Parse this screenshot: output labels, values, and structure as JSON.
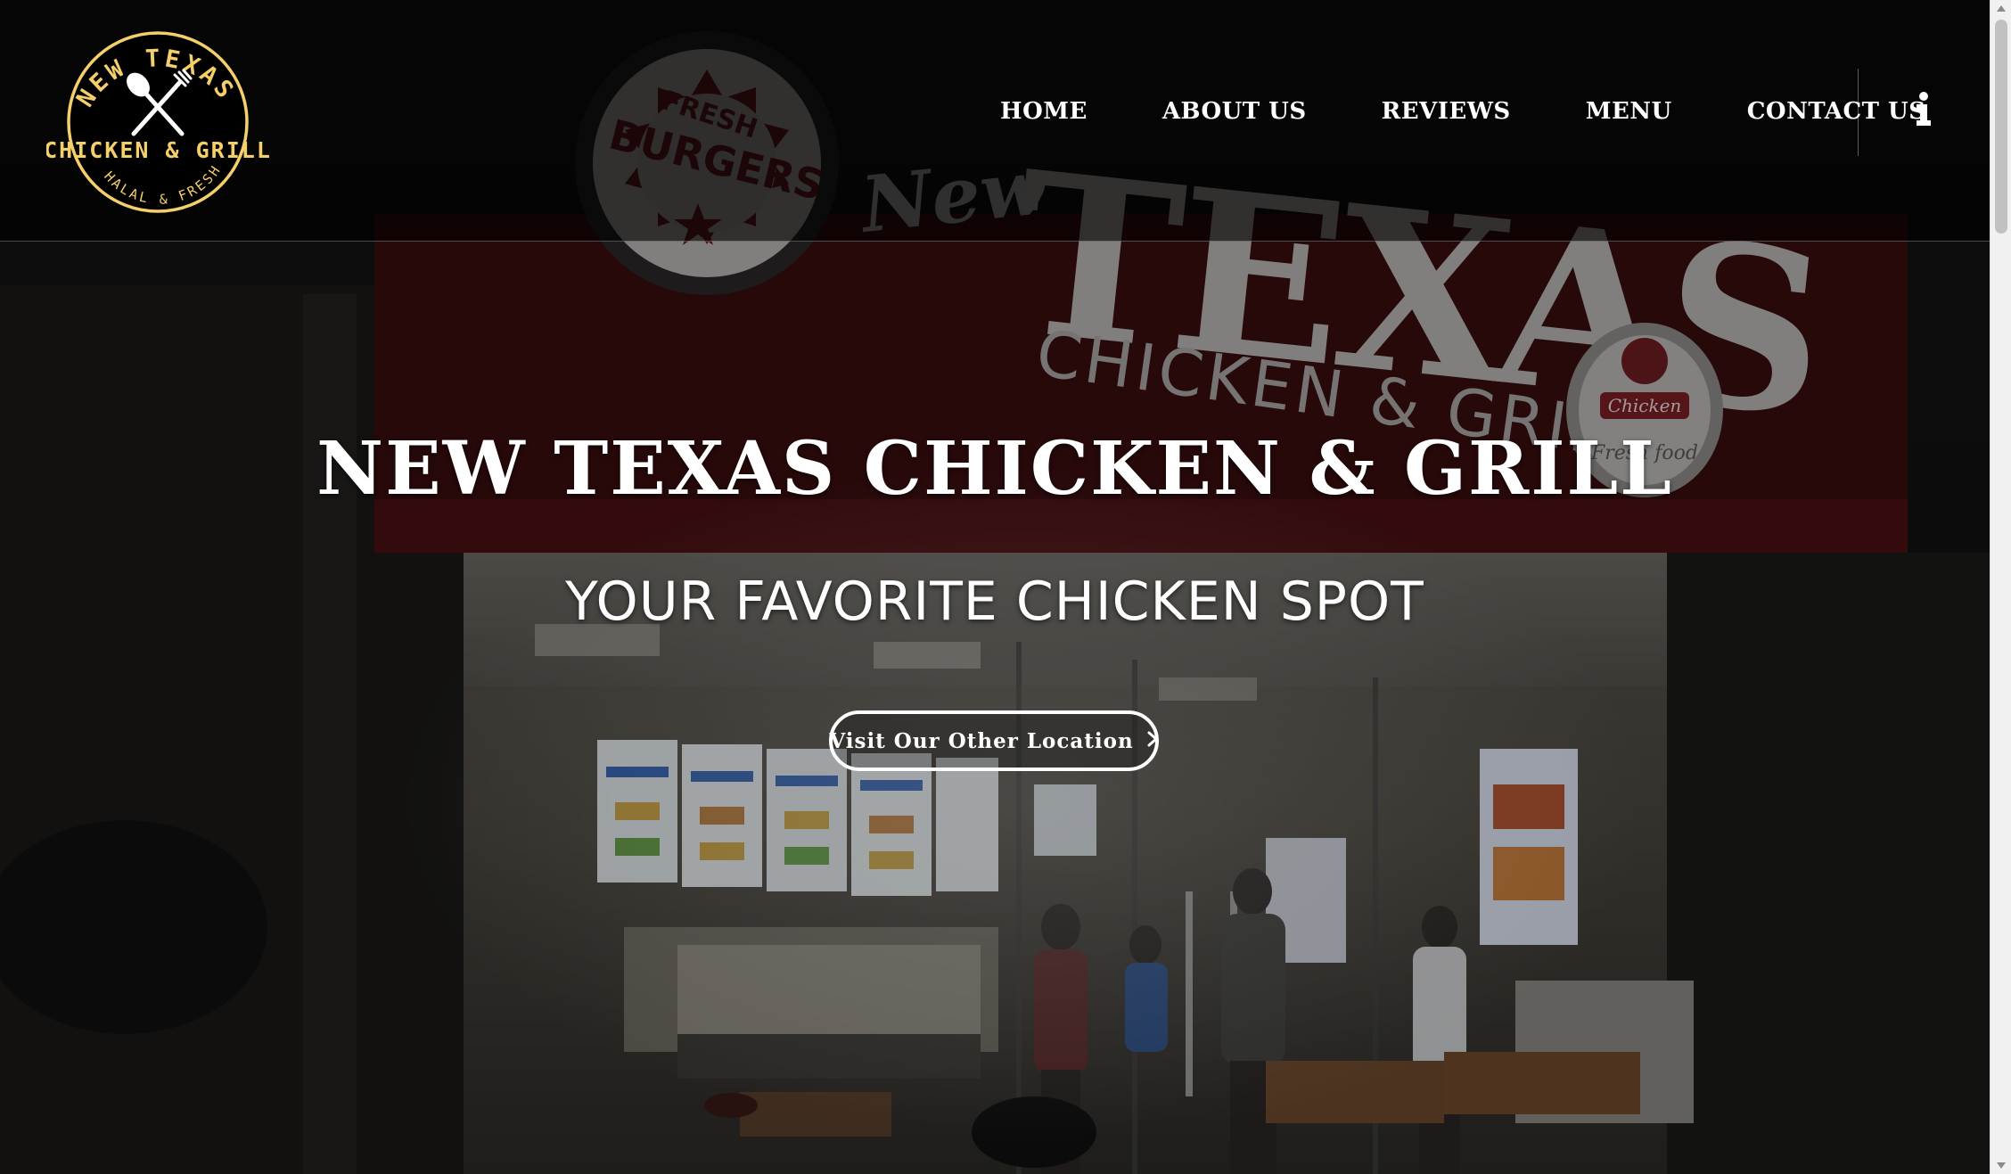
{
  "brand": {
    "logo_top_text": "NEW TEXAS",
    "logo_middle_text": "CHICKEN & GRILL",
    "logo_bottom_text": "HALAL & FRESH",
    "accent_color": "#f4cf6a"
  },
  "nav": {
    "items": [
      {
        "label": "HOME"
      },
      {
        "label": "ABOUT US"
      },
      {
        "label": "REVIEWS"
      },
      {
        "label": "MENU"
      },
      {
        "label": "CONTACT US"
      }
    ],
    "info_icon": "info-icon"
  },
  "hero": {
    "title": "NEW TEXAS CHICKEN & GRILL",
    "subtitle": "YOUR FAVORITE CHICKEN SPOT",
    "cta_label": "Visit Our Other Location",
    "cta_icon": "chevron-right-icon"
  },
  "storefront_sign": {
    "badge_top": "FRESH",
    "badge_main": "BURGERS",
    "script_word": "New",
    "main_word": "TEXAS",
    "sub_words": "CHICKEN & GRILL",
    "right_badge_word": "Chicken",
    "right_badge_script": "Fresh food"
  }
}
